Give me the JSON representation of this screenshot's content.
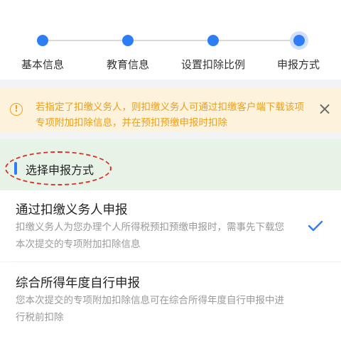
{
  "steps": [
    {
      "label": "基本信息"
    },
    {
      "label": "教育信息"
    },
    {
      "label": "设置扣除比例"
    },
    {
      "label": "申报方式"
    }
  ],
  "notice": {
    "text": "若指定了扣缴义务人，则扣缴义务人可通过扣缴客户端下载该项专项附加扣除信息，并在预扣预缴申报时扣除",
    "icon": "info-circle-icon",
    "close_icon": "close-icon"
  },
  "section": {
    "title": "选择申报方式"
  },
  "options": [
    {
      "title": "通过扣缴义务人申报",
      "description": "扣缴义务人为您办理个人所得税预扣预缴申报时，需事先下载您本次提交的专项附加扣除信息",
      "selected": true
    },
    {
      "title": "综合所得年度自行申报",
      "description": "您本次提交的专项附加扣除信息可在综合所得年度自行申报中进行税前扣除",
      "selected": false
    }
  ],
  "colors": {
    "accent": "#2f7df6",
    "warning": "#f0a020",
    "annotation": "#d9322e"
  }
}
